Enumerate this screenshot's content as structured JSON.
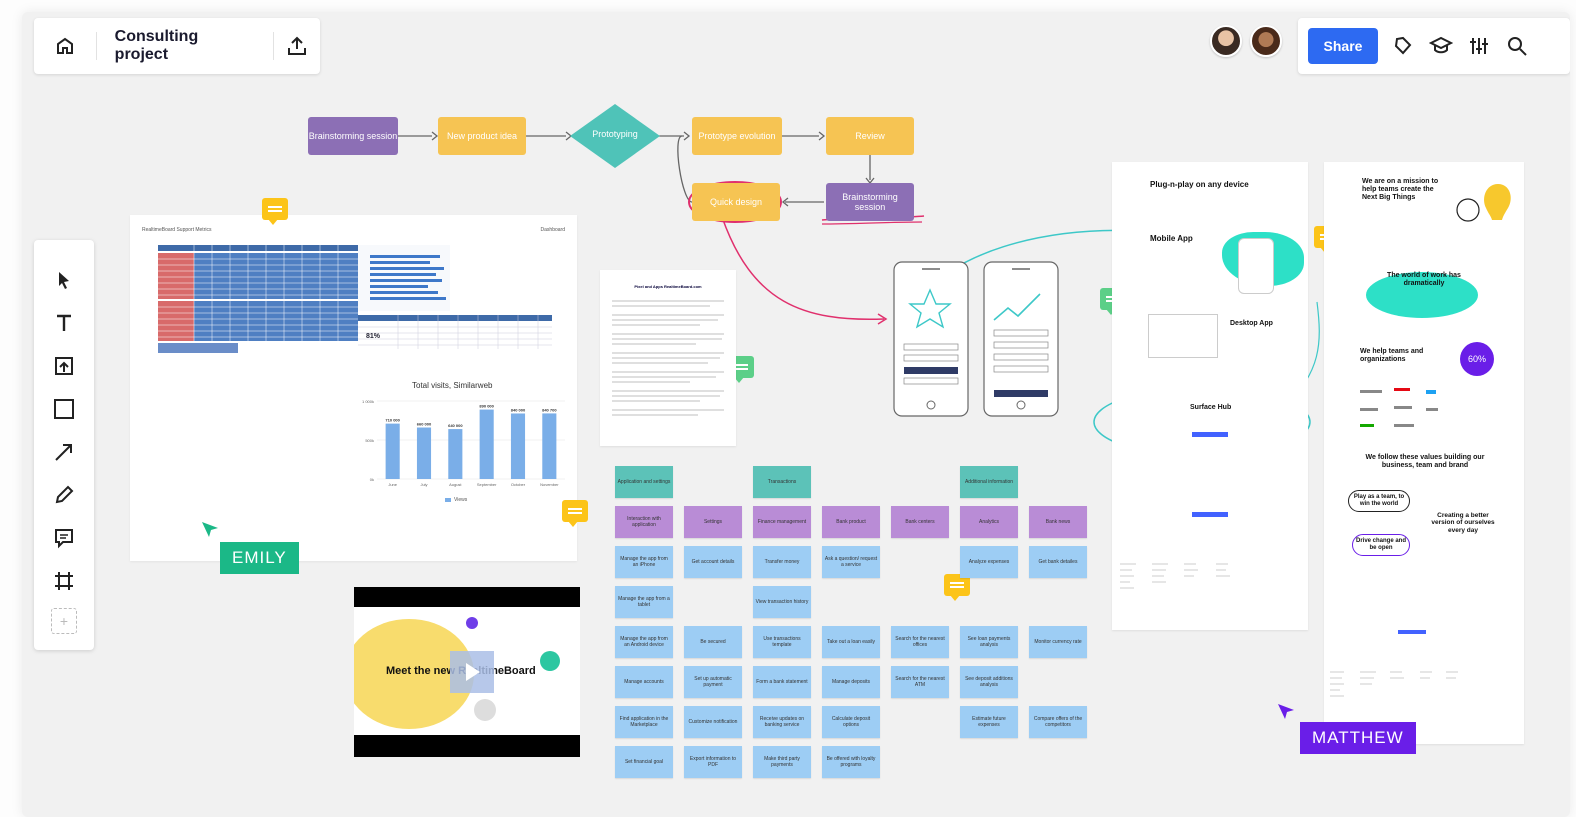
{
  "header": {
    "board_title": "Consulting project",
    "share_label": "Share"
  },
  "flowchart": {
    "nodes": [
      "Brainstorming session",
      "New product idea",
      "Prototyping",
      "Prototype evolution",
      "Review",
      "Quick design",
      "Brainstorming session"
    ]
  },
  "dashboard": {
    "title": "RealtimeBoard Support Metrics",
    "tab": "Dashboard",
    "chart_title": "Total visits, Similarweb",
    "big_number": "81%"
  },
  "chart_data": {
    "type": "bar",
    "title": "Total visits, Similarweb",
    "categories": [
      "June",
      "July",
      "August",
      "September",
      "October",
      "November"
    ],
    "values": [
      710000,
      660000,
      640000,
      890000,
      840000,
      840700
    ],
    "data_labels": [
      "710 000",
      "660 000",
      "640 000",
      "890 000",
      "840 000",
      "840 700"
    ],
    "y_ticks": [
      "1 000k",
      "500k",
      "0k"
    ],
    "ylim": [
      0,
      1000000
    ],
    "legend": [
      "Views"
    ],
    "color": "#7aaee8"
  },
  "doc": {
    "title": "Pixel and Apps RealtimeBoard.com"
  },
  "video": {
    "title": "Meet the new RealtimeBoard"
  },
  "cursors": {
    "emily": "EMILY",
    "matthew": "MATTHEW"
  },
  "stickies": {
    "headers_teal": [
      "Application and settings",
      "Transactions",
      "Additional information"
    ],
    "purple_row": [
      "Interaction with application",
      "Settings",
      "Finance management",
      "Bank product",
      "Bank centers",
      "Analytics",
      "Bank news"
    ],
    "col1": [
      "Manage the app from an iPhone",
      "Manage the app from a tablet",
      "Manage the app from an Android device",
      "Manage accounts",
      "Find application in the Marketplace",
      "Set financial goal"
    ],
    "col2": [
      "Get account details",
      "Be secured",
      "Set up automatic payment",
      "Customize notification",
      "Export information to PDF"
    ],
    "col3": [
      "Transfer money",
      "View transaction history",
      "Use transactions template",
      "Form a bank statement",
      "Receive updates on banking service",
      "Make third party payments"
    ],
    "col4": [
      "Ask a question/ request a service",
      "Take out a loan easily",
      "Manage deposits",
      "Calculate deposit options",
      "Be offered with loyalty programs"
    ],
    "col5": [
      "Search for the nearest offices",
      "Search for the nearest ATM"
    ],
    "col6": [
      "Analyze expenses",
      "See loan payments analysis",
      "See deposit additions analysis",
      "Estimate future expenses"
    ],
    "col7": [
      "Get bank detailes",
      "Monitor currency rate",
      "Compare offers of the competitors"
    ]
  },
  "landing1": {
    "h1": "Plug-n-play on any device",
    "mobile": "Mobile App",
    "desktop": "Desktop App",
    "surface": "Surface Hub"
  },
  "landing2": {
    "mission": "We are on a mission to help teams create the Next Big Things",
    "world": "The world of work has dramatically",
    "help": "We help teams and organizations",
    "percent": "60%",
    "values": "We follow these values building our business, team and brand",
    "v1": "Play as a team, to win the world",
    "v2": "Creating a better version of ourselves every day",
    "v3": "Drive change and be open"
  },
  "colors": {
    "accent": "#2d6af2",
    "purple_node": "#8c6fb5",
    "yellow_node": "#f6c453",
    "teal_diamond": "#4fc3b8",
    "emily": "#1bb887",
    "matthew": "#6a1ee8"
  }
}
